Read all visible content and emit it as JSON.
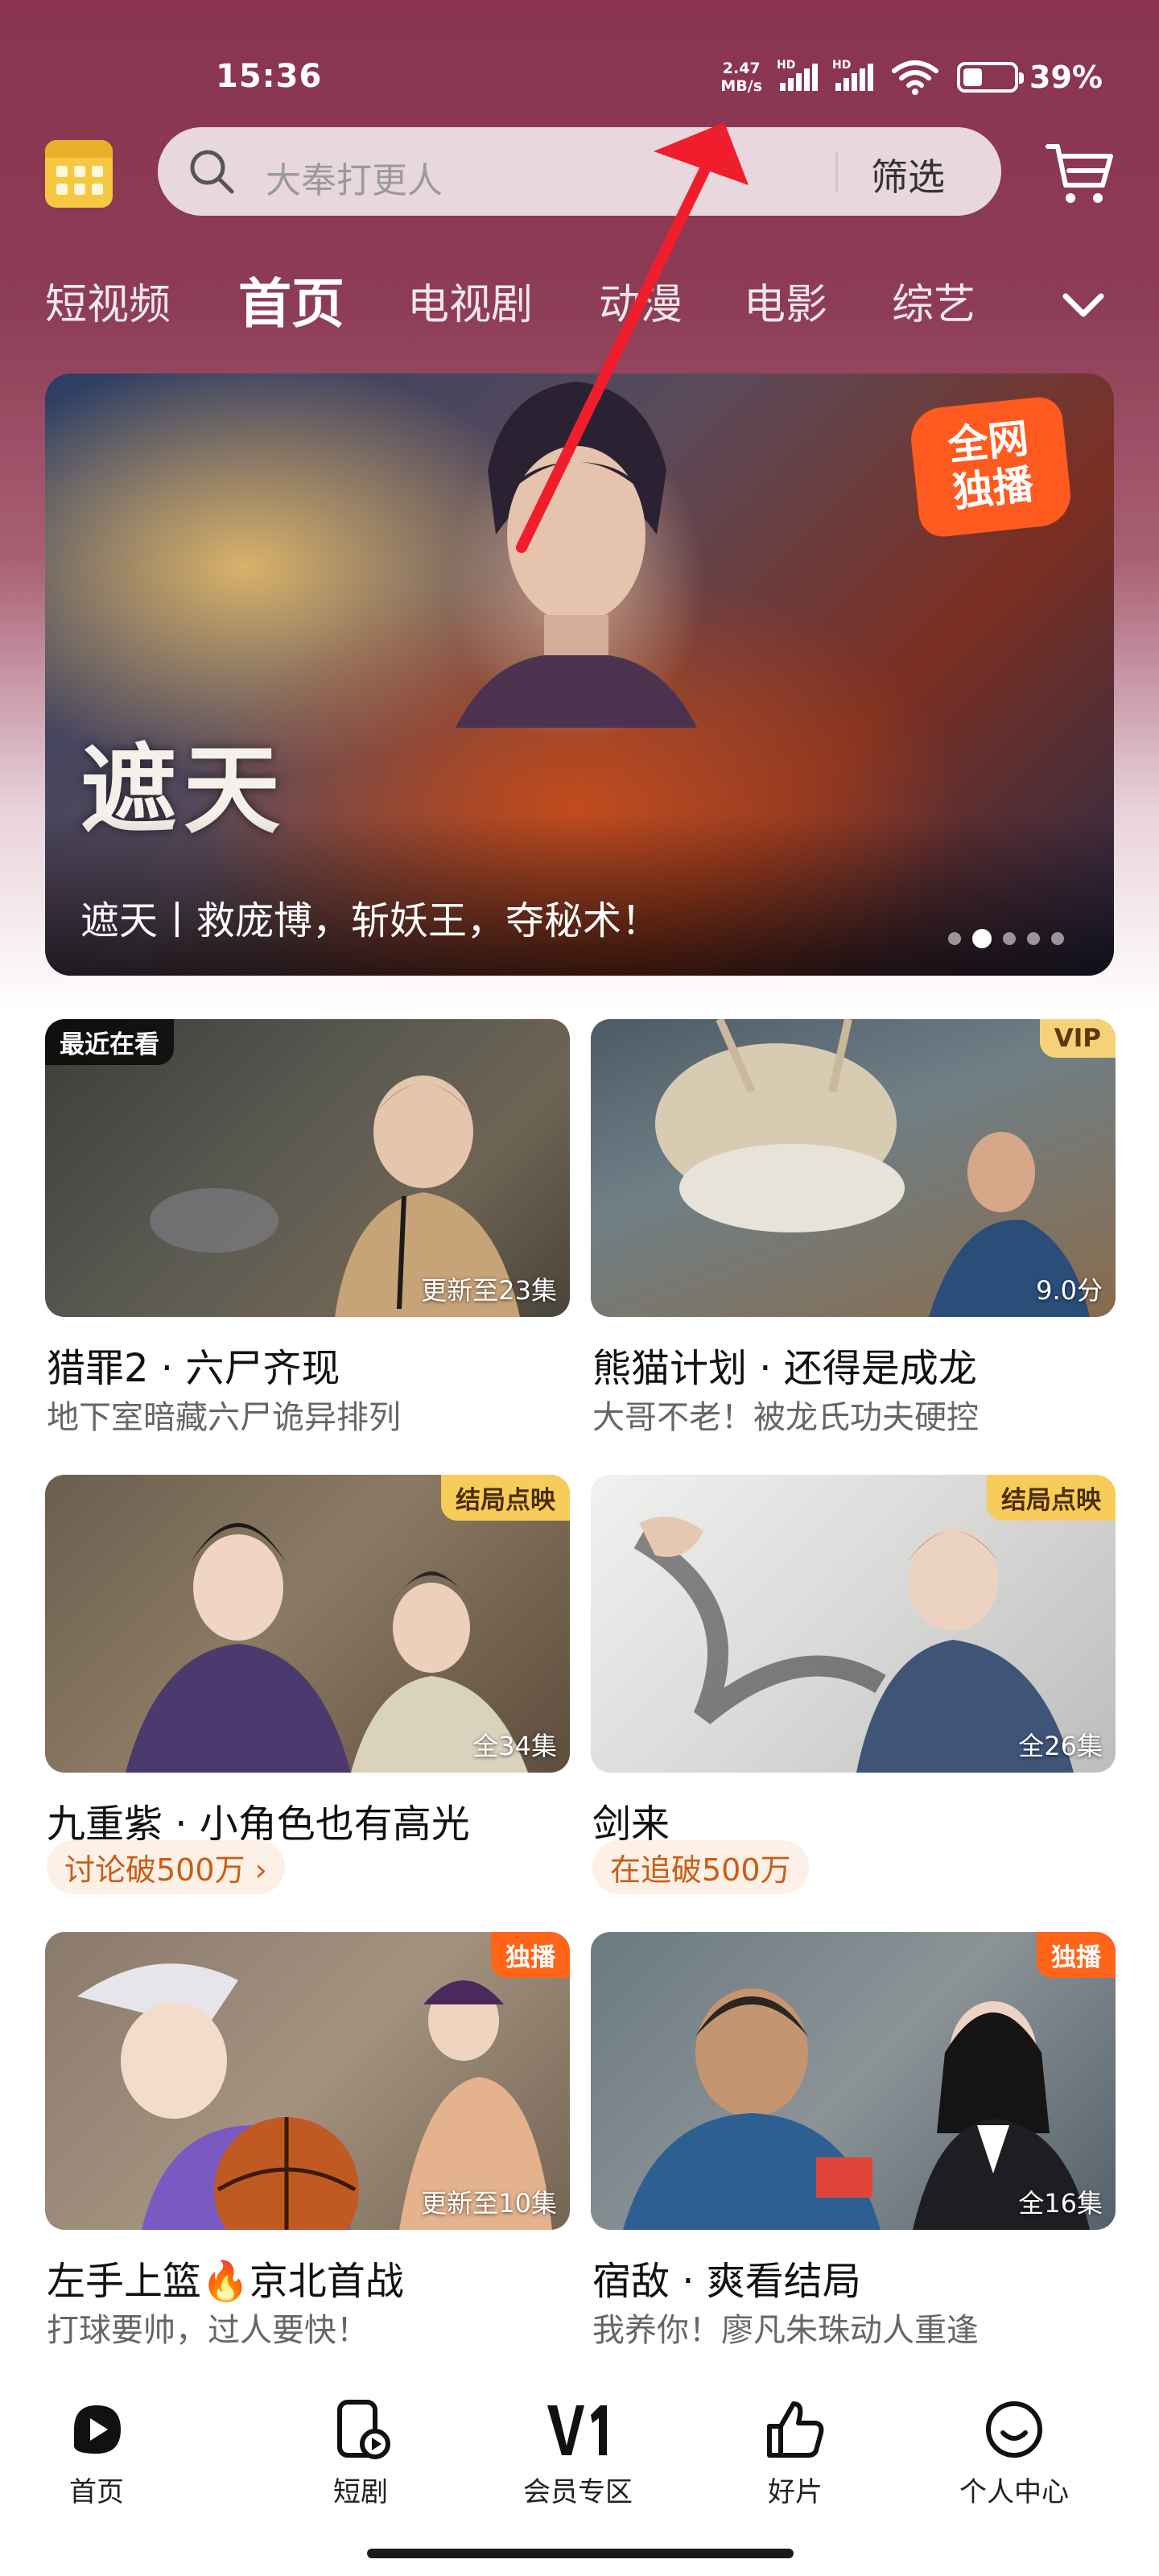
{
  "status_bar": {
    "time": "15:36",
    "net_speed_value": "2.47",
    "net_speed_unit": "MB/s",
    "sim1_label": "HD",
    "sim2_label": "HD",
    "battery_text": "39%",
    "battery_level": 0.39
  },
  "header": {
    "calendar_icon": "calendar-icon",
    "search_placeholder": "大奉打更人",
    "filter_label": "筛选",
    "cart_icon": "shopping-cart-icon"
  },
  "tabs": [
    {
      "label": "短视频",
      "active": false
    },
    {
      "label": "首页",
      "active": true
    },
    {
      "label": "电视剧",
      "active": false
    },
    {
      "label": "动漫",
      "active": false
    },
    {
      "label": "电影",
      "active": false
    },
    {
      "label": "综艺",
      "active": false
    }
  ],
  "banner": {
    "badge_line1": "全网",
    "badge_line2": "独播",
    "logo_text": "遮天",
    "caption": "遮天丨救庞博，斩妖王，夺秘术！",
    "page_count": 5,
    "active_page": 1
  },
  "cards": [
    {
      "title": "猎罪2 · 六尸齐现",
      "subtitle": "地下室暗藏六尸诡异排列",
      "tag": "最近在看",
      "thumb_label": "更新至23集"
    },
    {
      "title": "熊猫计划 · 还得是成龙",
      "subtitle": "大哥不老！被龙氏功夫硬控",
      "tag": "VIP",
      "thumb_label": "9.0分"
    },
    {
      "title": "九重紫 · 小角色也有高光",
      "pill": "讨论破500万 ›",
      "tag": "结局点映",
      "thumb_label": "全34集"
    },
    {
      "title": "剑来",
      "pill": "在追破500万",
      "tag": "结局点映",
      "thumb_label": "全26集"
    },
    {
      "title": "左手上篮🔥京北首战",
      "subtitle": "打球要帅，过人要快！",
      "tag": "独播",
      "thumb_label": "更新至10集"
    },
    {
      "title": "宿敌 · 爽看结局",
      "subtitle": "我养你！廖凡朱珠动人重逢",
      "tag": "独播",
      "thumb_label": "全16集"
    }
  ],
  "bottom_nav": [
    {
      "label": "首页",
      "icon": "home-play-icon"
    },
    {
      "label": "短剧",
      "icon": "short-drama-icon"
    },
    {
      "label": "会员专区",
      "icon": "vip-v1-icon"
    },
    {
      "label": "好片",
      "icon": "thumbs-up-icon"
    },
    {
      "label": "个人中心",
      "icon": "profile-icon"
    }
  ],
  "colors": {
    "header_bg": "#8a3450",
    "accent_orange": "#ff6419",
    "vip_gold": "#f5d27a",
    "pill_text": "#c95d16",
    "annotation_red": "#f01e2c"
  }
}
